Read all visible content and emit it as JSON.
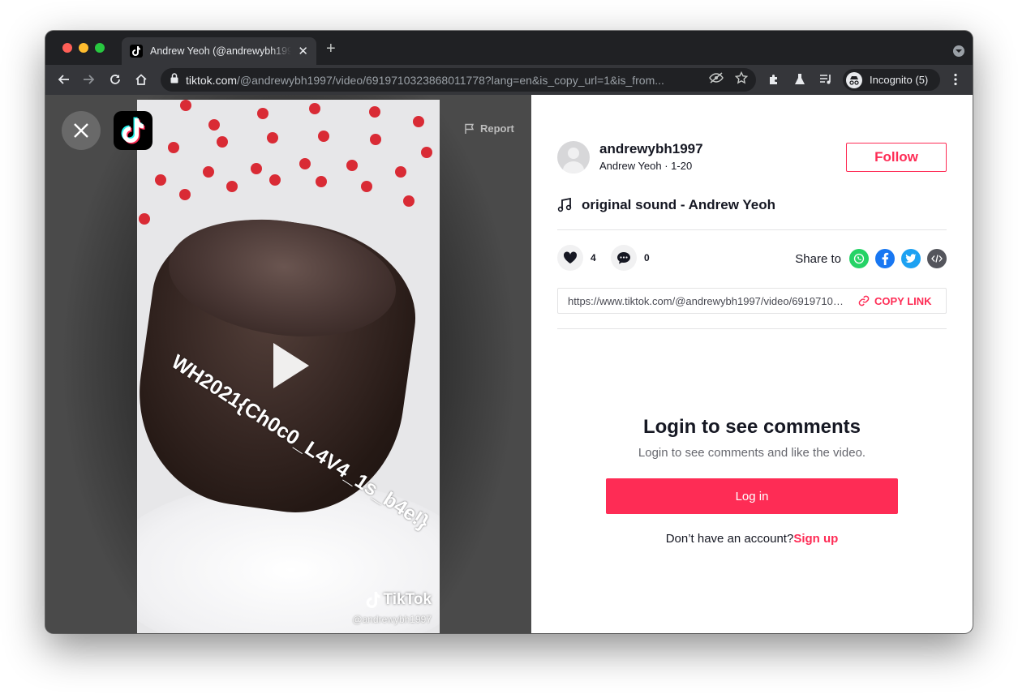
{
  "browser": {
    "tab_title": "Andrew Yeoh (@andrewybh1997",
    "url_host": "tiktok.com",
    "url_path": "/@andrewybh1997/video/6919710323868011778?lang=en&is_copy_url=1&is_from...",
    "incognito_label": "Incognito (5)"
  },
  "video": {
    "report_label": "Report",
    "overlay_text": "WH2021{Ch0c0_L4V4_1s_b4e!}",
    "watermark_logo": "TikTok",
    "watermark_user": "@andrewybh1997"
  },
  "author": {
    "username": "andrewybh1997",
    "subline": "Andrew Yeoh · 1-20",
    "follow_label": "Follow"
  },
  "music": {
    "title": "original sound - Andrew Yeoh"
  },
  "actions": {
    "likes": "4",
    "comments": "0",
    "share_label": "Share to"
  },
  "copy": {
    "url": "https://www.tiktok.com/@andrewybh1997/video/6919710323868011778?lang=en&is_copy_url=1&is_from_webapp=v1",
    "button_label": "COPY LINK"
  },
  "comments": {
    "title": "Login to see comments",
    "subtitle": "Login to see comments and like the video.",
    "login_label": "Log in",
    "signup_prompt": "Don’t have an account?",
    "signup_label": "Sign up"
  },
  "colors": {
    "brand": "#fe2c55",
    "chrome_dark": "#202124",
    "chrome_toolbar": "#35363a"
  },
  "icons": [
    "close-icon",
    "tiktok-logo-icon",
    "flag-icon",
    "music-note-icon",
    "heart-icon",
    "comment-icon",
    "whatsapp-icon",
    "facebook-icon",
    "twitter-icon",
    "embed-icon",
    "link-icon",
    "play-icon"
  ]
}
